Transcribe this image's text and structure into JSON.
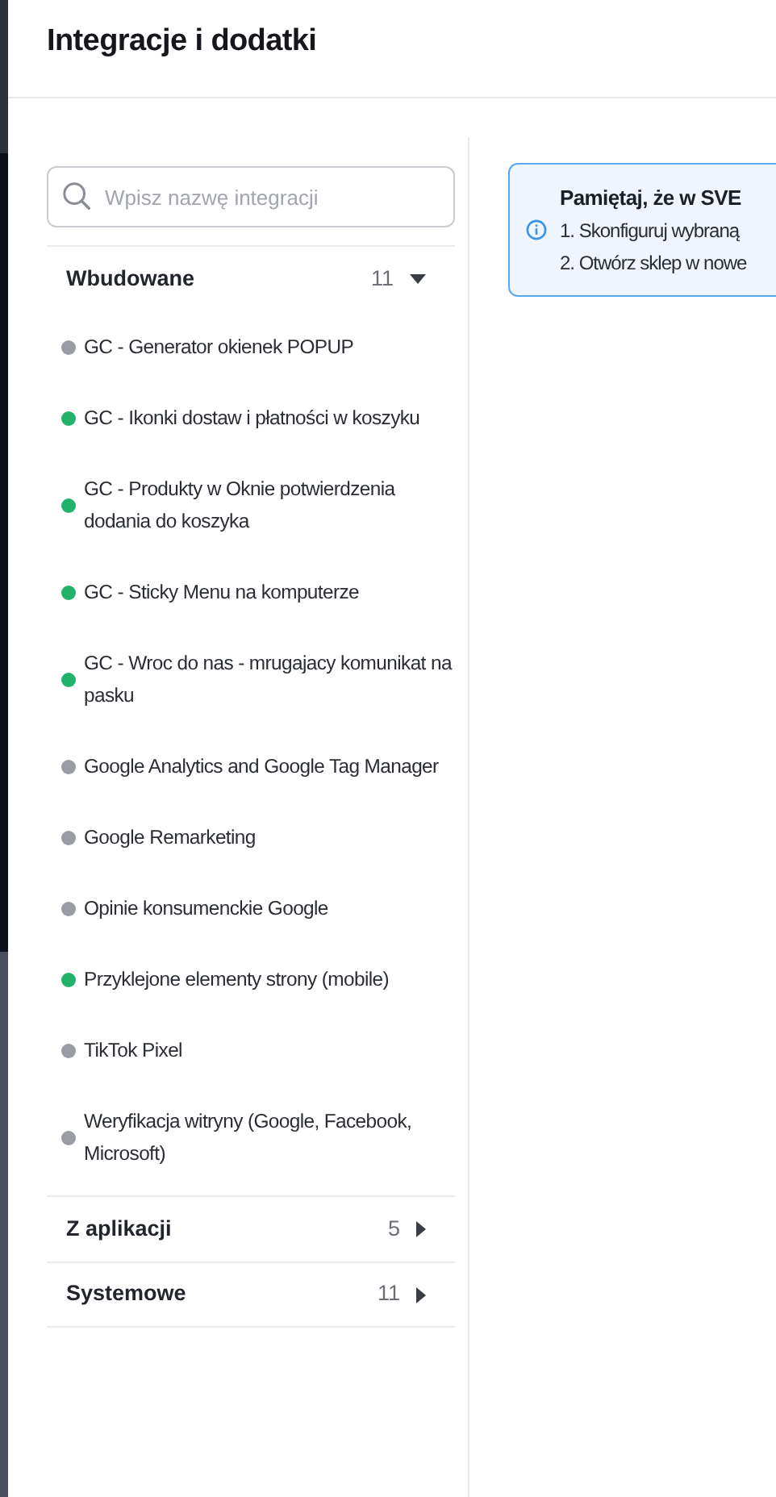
{
  "title": "Integracje i dodatki",
  "search": {
    "placeholder": "Wpisz nazwę integracji"
  },
  "groups": [
    {
      "label": "Wbudowane",
      "count": "11",
      "expanded": true,
      "items": [
        {
          "label": "GC - Generator okienek POPUP",
          "active": false
        },
        {
          "label": "GC - Ikonki dostaw i płatności w koszyku",
          "active": true
        },
        {
          "label": "GC - Produkty w Oknie potwierdzenia dodania do koszyka",
          "active": true
        },
        {
          "label": "GC - Sticky Menu na komputerze",
          "active": true
        },
        {
          "label": "GC - Wroc do nas - mrugajacy komunikat na pasku",
          "active": true
        },
        {
          "label": "Google Analytics and Google Tag Manager",
          "active": false
        },
        {
          "label": "Google Remarketing",
          "active": false
        },
        {
          "label": "Opinie konsumenckie Google",
          "active": false
        },
        {
          "label": "Przyklejone elementy strony (mobile)",
          "active": true
        },
        {
          "label": "TikTok Pixel",
          "active": false
        },
        {
          "label": "Weryfikacja witryny (Google, Facebook, Microsoft)",
          "active": false
        }
      ]
    },
    {
      "label": "Z aplikacji",
      "count": "5",
      "expanded": false
    },
    {
      "label": "Systemowe",
      "count": "11",
      "expanded": false
    }
  ],
  "alert": {
    "title": "Pamiętaj, że w SVE",
    "lines": [
      "1. Skonfiguruj wybraną",
      "2. Otwórz sklep w nowe"
    ]
  }
}
